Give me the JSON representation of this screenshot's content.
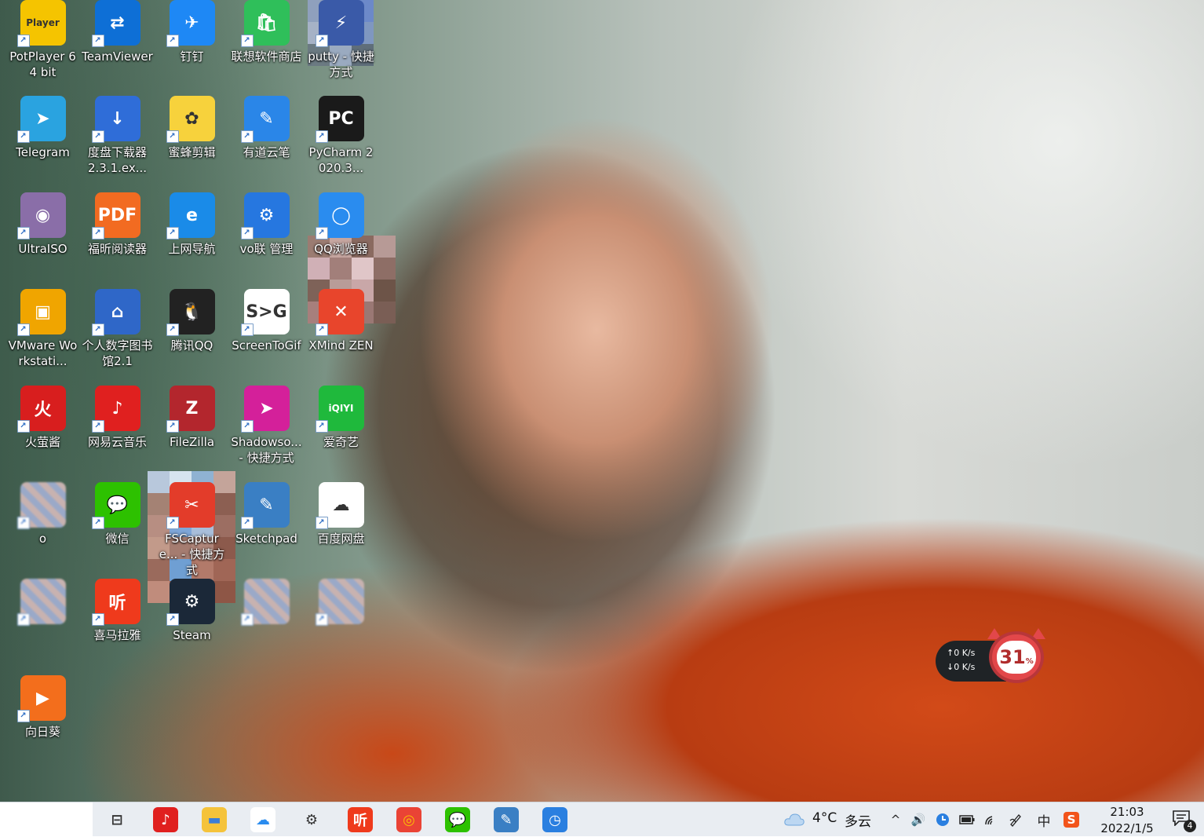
{
  "desktop": {
    "icons": [
      {
        "label": "PotPlayer 64 bit",
        "glyph_text": "Player",
        "color": "#f5c400",
        "icon": "potplayer-icon"
      },
      {
        "label": "TeamViewer",
        "glyph_text": "⇄",
        "color": "#0e6fd6",
        "icon": "teamviewer-icon"
      },
      {
        "label": "钉钉",
        "glyph_text": "✈",
        "color": "#1e88f5",
        "icon": "dingtalk-icon"
      },
      {
        "label": "联想软件商店",
        "glyph_text": "🛍",
        "color": "#2fbf5a",
        "icon": "lenovo-store-icon"
      },
      {
        "label": "putty - 快捷方式",
        "glyph_text": "⚡",
        "color": "#3a5aa8",
        "icon": "putty-icon"
      },
      {
        "label": "Telegram",
        "glyph_text": "➤",
        "color": "#2aa3e0",
        "icon": "telegram-icon"
      },
      {
        "label": "度盘下载器 2.3.1.ex...",
        "glyph_text": "↓",
        "color": "#2f6dd8",
        "icon": "downloader-icon"
      },
      {
        "label": "蜜蜂剪辑",
        "glyph_text": "✿",
        "color": "#f7d23c",
        "icon": "bee-editor-icon"
      },
      {
        "label": "有道云笔",
        "glyph_text": "✎",
        "color": "#2a86e8",
        "icon": "youdao-note-icon"
      },
      {
        "label": "PyCharm 2020.3...",
        "glyph_text": "PC",
        "color": "#1a1a1a",
        "icon": "pycharm-icon"
      },
      {
        "label": "UltraISO",
        "glyph_text": "◉",
        "color": "#8a6ea8",
        "icon": "ultraiso-icon"
      },
      {
        "label": "福昕阅读器",
        "glyph_text": "PDF",
        "color": "#f26b21",
        "icon": "foxit-reader-icon"
      },
      {
        "label": "上网导航",
        "glyph_text": "e",
        "color": "#1a8be8",
        "icon": "browser-nav-icon"
      },
      {
        "label": "vo联 管理",
        "glyph_text": "⚙",
        "color": "#2677e0",
        "icon": "vpn-manager-icon"
      },
      {
        "label": "QQ浏览器",
        "glyph_text": "◯",
        "color": "#2a8cef",
        "icon": "qq-browser-icon"
      },
      {
        "label": "VMware Workstati...",
        "glyph_text": "▣",
        "color": "#f0a500",
        "icon": "vmware-icon"
      },
      {
        "label": "个人数字图书馆2.1",
        "glyph_text": "⌂",
        "color": "#2f67c8",
        "icon": "digital-library-icon"
      },
      {
        "label": "腾讯QQ",
        "glyph_text": "🐧",
        "color": "#222222",
        "icon": "qq-icon"
      },
      {
        "label": "ScreenToGif",
        "glyph_text": "S>G",
        "color": "#ffffff",
        "icon": "screentogif-icon"
      },
      {
        "label": "XMind ZEN",
        "glyph_text": "✕",
        "color": "#e8452c",
        "icon": "xmind-icon"
      },
      {
        "label": "火萤酱",
        "glyph_text": "火",
        "color": "#d81e1e",
        "icon": "huoying-icon"
      },
      {
        "label": "网易云音乐",
        "glyph_text": "♪",
        "color": "#e0201f",
        "icon": "netease-music-icon"
      },
      {
        "label": "FileZilla",
        "glyph_text": "Z",
        "color": "#b3262d",
        "icon": "filezilla-icon"
      },
      {
        "label": "Shadowso... - 快捷方式",
        "glyph_text": "➤",
        "color": "#d4209a",
        "icon": "shadowsocks-icon"
      },
      {
        "label": "爱奇艺",
        "glyph_text": "iQIYI",
        "color": "#1fb93c",
        "icon": "iqiyi-icon"
      },
      {
        "label": "o",
        "glyph_text": "",
        "color": "#7ab8e0",
        "icon": "blurred-app-icon"
      },
      {
        "label": "微信",
        "glyph_text": "💬",
        "color": "#2dc100",
        "icon": "wechat-icon"
      },
      {
        "label": "FSCapture... - 快捷方式",
        "glyph_text": "✂",
        "color": "#e33c2a",
        "icon": "fscapture-icon"
      },
      {
        "label": "Sketchpad",
        "glyph_text": "✎",
        "color": "#3a7fc4",
        "icon": "sketchpad-icon"
      },
      {
        "label": "百度网盘",
        "glyph_text": "☁",
        "color": "#ffffff",
        "icon": "baidu-netdisk-icon"
      },
      {
        "label": "",
        "glyph_text": "",
        "color": "#4d86c8",
        "icon": "blurred-app-icon"
      },
      {
        "label": "喜马拉雅",
        "glyph_text": "听",
        "color": "#ef3a1c",
        "icon": "ximalaya-icon"
      },
      {
        "label": "Steam",
        "glyph_text": "⚙",
        "color": "#1b2838",
        "icon": "steam-icon"
      },
      {
        "label": "",
        "glyph_text": "",
        "color": "#5cb878",
        "icon": "blurred-app-icon"
      },
      {
        "label": "",
        "glyph_text": "",
        "color": "#3c6fb8",
        "icon": "blurred-app-icon"
      },
      {
        "label": "向日葵",
        "glyph_text": "▶",
        "color": "#f36e1c",
        "icon": "sunlogin-icon"
      }
    ]
  },
  "net_monitor": {
    "upload": "↑0  K/s",
    "download": "↓0  K/s",
    "percent": "31",
    "percent_unit": "%"
  },
  "taskbar": {
    "apps": [
      {
        "name": "task-view-icon",
        "glyph": "⊟",
        "color": "#e9edf2",
        "fg": "#333"
      },
      {
        "name": "netease-music-icon",
        "glyph": "♪",
        "color": "#e0201f",
        "fg": "#fff"
      },
      {
        "name": "file-explorer-icon",
        "glyph": "▬",
        "color": "#f5c33b",
        "fg": "#3b7dd8"
      },
      {
        "name": "baidu-netdisk-icon",
        "glyph": "☁",
        "color": "#ffffff",
        "fg": "#2a8cef"
      },
      {
        "name": "settings-icon",
        "glyph": "⚙",
        "color": "#e9edf2",
        "fg": "#333"
      },
      {
        "name": "ximalaya-icon",
        "glyph": "听",
        "color": "#ef3a1c",
        "fg": "#fff"
      },
      {
        "name": "chrome-icon",
        "glyph": "◎",
        "color": "#ea4335",
        "fg": "#fbbc05"
      },
      {
        "name": "wechat-icon",
        "glyph": "💬",
        "color": "#2dc100",
        "fg": "#fff"
      },
      {
        "name": "sketchpad-icon",
        "glyph": "✎",
        "color": "#3a7fc4",
        "fg": "#fff"
      },
      {
        "name": "clock-app-icon",
        "glyph": "◷",
        "color": "#2a7fe0",
        "fg": "#fff"
      }
    ],
    "weather": {
      "temp": "4°C",
      "desc": "多云"
    },
    "tray": {
      "chevron": "^",
      "volume": "🔊",
      "input_lang": "中",
      "sogou": "S"
    },
    "clock": {
      "time": "21:03",
      "date": "2022/1/5"
    },
    "notifications": {
      "count": "4"
    }
  }
}
